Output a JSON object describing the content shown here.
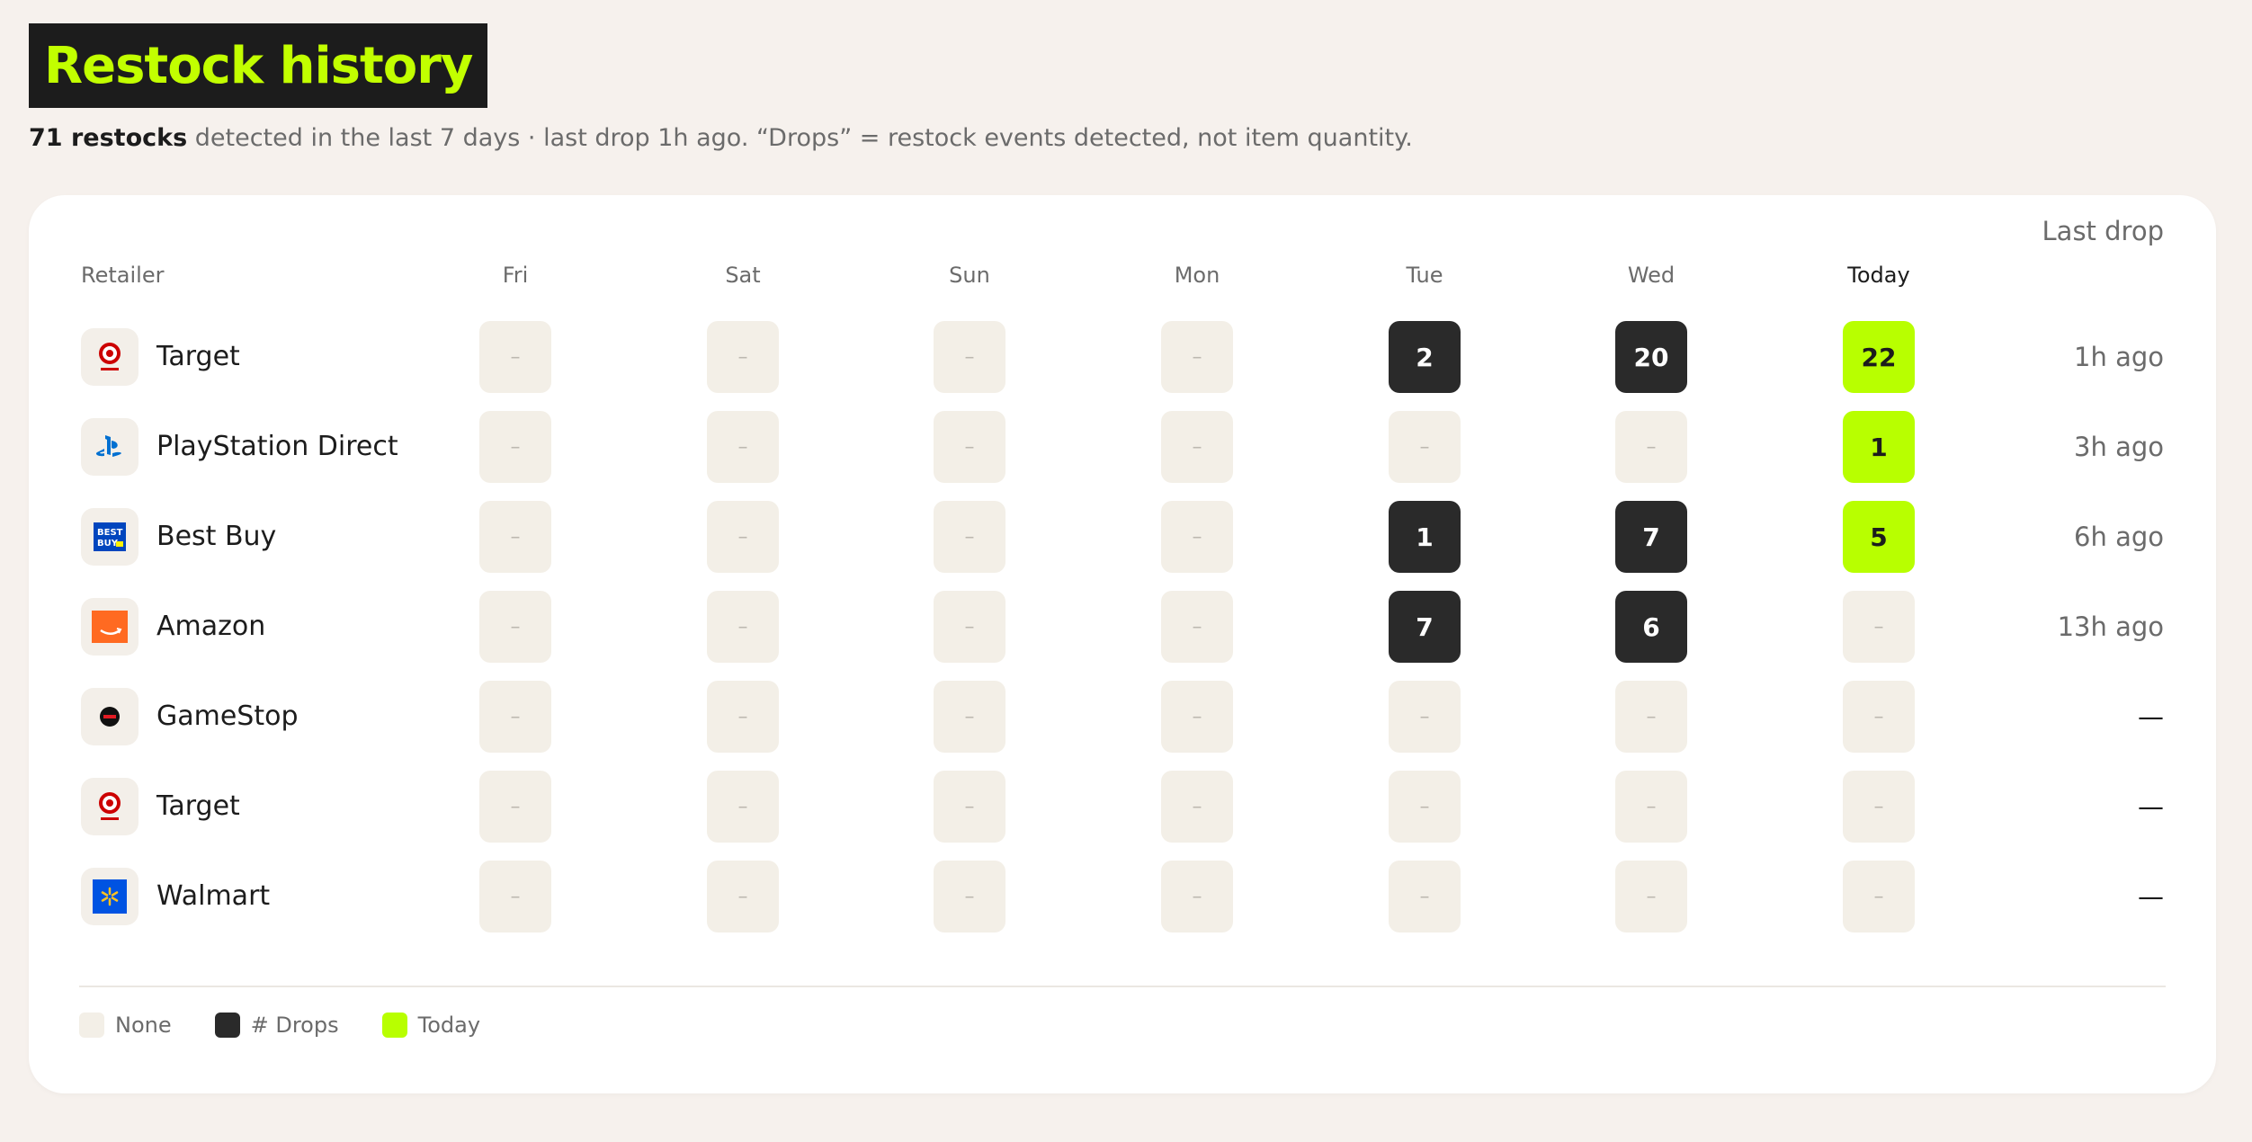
{
  "header": {
    "title": "Restock history",
    "summary_bold": "71 restocks",
    "summary_rest": " detected in the last 7 days · last drop 1h ago. “Drops” = restock events detected, not item quantity."
  },
  "table": {
    "retailer_header": "Retailer",
    "days": [
      "Fri",
      "Sat",
      "Sun",
      "Mon",
      "Tue",
      "Wed",
      "Today"
    ],
    "last_header": "Last drop",
    "empty_cell": "–",
    "rows": [
      {
        "name": "Target",
        "logo": "target-logo",
        "cells": [
          "–",
          "–",
          "–",
          "–",
          "2",
          "20",
          "22"
        ],
        "last": "1h ago"
      },
      {
        "name": "PlayStation Direct",
        "logo": "playstation-logo",
        "cells": [
          "–",
          "–",
          "–",
          "–",
          "–",
          "–",
          "1"
        ],
        "last": "3h ago"
      },
      {
        "name": "Best Buy",
        "logo": "bestbuy-logo",
        "cells": [
          "–",
          "–",
          "–",
          "–",
          "1",
          "7",
          "5"
        ],
        "last": "6h ago"
      },
      {
        "name": "Amazon",
        "logo": "amazon-logo",
        "cells": [
          "–",
          "–",
          "–",
          "–",
          "7",
          "6",
          "–"
        ],
        "last": "13h ago"
      },
      {
        "name": "GameStop",
        "logo": "gamestop-logo",
        "cells": [
          "–",
          "–",
          "–",
          "–",
          "–",
          "–",
          "–"
        ],
        "last": "—"
      },
      {
        "name": "Target",
        "logo": "target-logo",
        "cells": [
          "–",
          "–",
          "–",
          "–",
          "–",
          "–",
          "–"
        ],
        "last": "—"
      },
      {
        "name": "Walmart",
        "logo": "walmart-logo",
        "cells": [
          "–",
          "–",
          "–",
          "–",
          "–",
          "–",
          "–"
        ],
        "last": "—"
      }
    ]
  },
  "legend": [
    {
      "label": "None",
      "color": "#f3efe7"
    },
    {
      "label": "# Drops",
      "color": "#2a2a2a"
    },
    {
      "label": "Today",
      "color": "#b8ff00"
    }
  ],
  "colors": {
    "accent": "#c2ff00",
    "today_cell": "#b8ff00",
    "drop_cell": "#2a2a2a",
    "empty_cell": "#f3efe7"
  }
}
